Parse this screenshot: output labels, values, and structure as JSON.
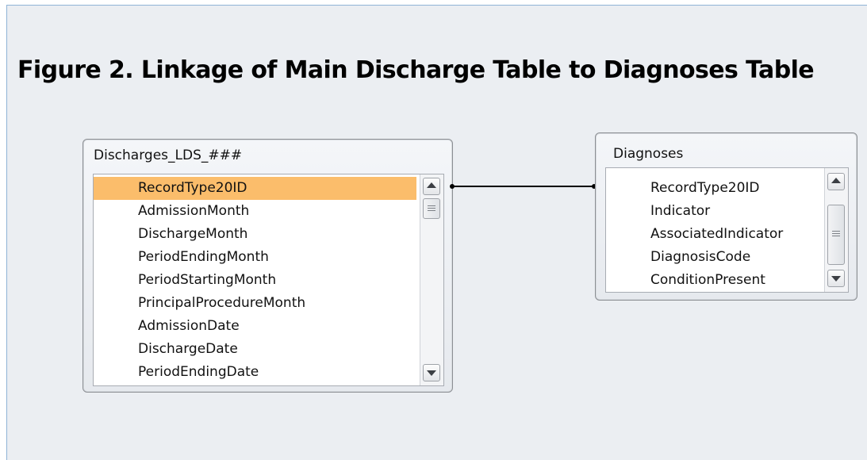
{
  "figure": {
    "title": "Figure 2. Linkage of Main Discharge Table to Diagnoses Table"
  },
  "discharges_table": {
    "title": "Discharges_LDS_###",
    "fields": [
      "RecordType20ID",
      "AdmissionMonth",
      "DischargeMonth",
      "PeriodEndingMonth",
      "PeriodStartingMonth",
      "PrincipalProcedureMonth",
      "AdmissionDate",
      "DischargeDate",
      "PeriodEndingDate"
    ],
    "selected_field": "RecordType20ID"
  },
  "diagnoses_table": {
    "title": "Diagnoses",
    "fields": [
      "RecordType20ID",
      "Indicator",
      "AssociatedIndicator",
      "DiagnosisCode",
      "ConditionPresent"
    ]
  },
  "relationship": {
    "from": "RecordType20ID",
    "to": "RecordType20ID"
  },
  "colors": {
    "selection": "#fbbd6b",
    "canvas": "#ebeef2",
    "frame_border": "#8fb3d6"
  },
  "icons": [
    "scroll-up-arrow-icon",
    "scroll-down-arrow-icon",
    "scroll-grip-icon"
  ]
}
